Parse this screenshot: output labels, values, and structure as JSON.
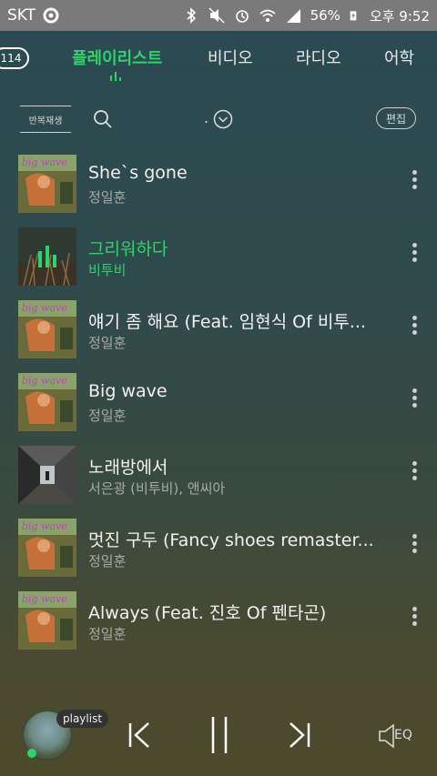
{
  "statusbar": {
    "carrier": "SKT",
    "battery": "56%",
    "time": "오후 9:52"
  },
  "tabs": {
    "count": "114",
    "items": [
      "플레이리스트",
      "비디오",
      "라디오",
      "어학"
    ],
    "active_color": "#2fd36a"
  },
  "toolbar": {
    "repeat_label": "반복재생",
    "dot": ".",
    "edit_label": "편집"
  },
  "tracks": [
    {
      "title": "She`s gone",
      "artist": "정일훈",
      "art": "bigwave"
    },
    {
      "title": "그리워하다",
      "artist": "비투비",
      "art": "reeds",
      "playing": true
    },
    {
      "title": "얘기 좀 해요 (Feat. 임현식 Of 비투...",
      "artist": "정일훈",
      "art": "bigwave"
    },
    {
      "title": "Big wave",
      "artist": "정일훈",
      "art": "bigwave"
    },
    {
      "title": "노래방에서",
      "artist": "서은광 (비투비), 앤씨아",
      "art": "corridor"
    },
    {
      "title": "멋진 구두 (Fancy shoes remaster...",
      "artist": "정일훈",
      "art": "bigwave"
    },
    {
      "title": "Always (Feat. 진호 Of 펜타곤)",
      "artist": "정일훈",
      "art": "bigwave"
    }
  ],
  "player": {
    "playlist_label": "playlist",
    "eq_label": "EQ"
  },
  "icons": {
    "search": "search-icon",
    "sort": "chevron-down-icon",
    "more": "more-vertical-icon",
    "prev": "previous-icon",
    "pause": "pause-icon",
    "next": "next-icon",
    "eq": "speaker-eq-icon"
  }
}
